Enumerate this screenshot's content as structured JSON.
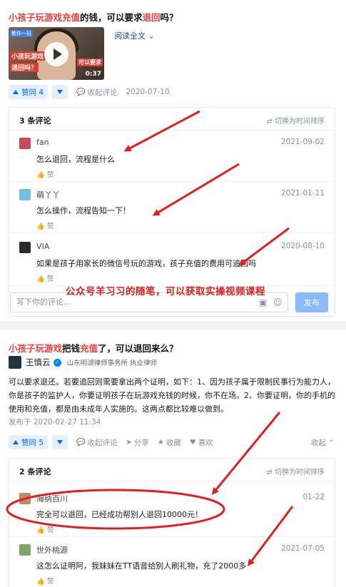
{
  "q1": {
    "title_parts": [
      "小孩子玩游戏充值",
      "的钱，可以要求",
      "退回",
      "吗？"
    ],
    "video": {
      "duration": "0:37",
      "tag": "教你一招",
      "overlay_line1": "小孩玩游戏",
      "overlay_line2": "退回吗？",
      "overlay_line3": "可以要求"
    },
    "read_all": "阅读全文 ⌄",
    "vote_up_label": "赞同 4",
    "collapse_comments": "收起评论",
    "date": "2020-07-10",
    "comments_box": {
      "count_label": "3 条评论",
      "sort_label": "切换为时间排序",
      "comments": [
        {
          "name": "fan",
          "time": "2021-09-02",
          "text": "怎么退回，流程是什么",
          "like": "赞"
        },
        {
          "name": "萌丫丫",
          "time": "2021-01-11",
          "text": "怎么操作，流程告知一下！",
          "like": "赞"
        },
        {
          "name": "VIA",
          "time": "2020-08-10",
          "text": "如果是孩子用家长的微信号玩的游戏，孩子充值的费用可追回吗",
          "like": "赞"
        }
      ],
      "input_placeholder": "写下你的评论...",
      "publish_label": "发布"
    },
    "overlay_caption": "公众号羊习习的随笔，可以获取实操视频课程"
  },
  "q2": {
    "title_parts": [
      "小孩子玩游戏",
      "把钱",
      "充值",
      "了，可以退回来么？"
    ],
    "author": {
      "name": "王慎云",
      "description": "山东明湖律师事务所 执业律师"
    },
    "answer_text": "可以要求退还。若要追回则需要拿出两个证明，如下：1、因为孩子属于限制民事行为能力人，你是孩子的监护人，你要证明孩子在玩游戏充钱的时候，你不在场。2、你要证明，你的手机的使用和充值，都是由未成年人实施的。这两点都比较难以做到。",
    "published": "发布于 2020-02-27 11:34",
    "vote_up_label": "赞同 5",
    "actions": {
      "collapse_comments": "收起评论",
      "share": "分享",
      "favorite": "收藏",
      "like": "喜欢",
      "collapse": "收起"
    },
    "comments_box": {
      "count_label": "2 条评论",
      "sort_label": "切换为时间排序",
      "comments": [
        {
          "name": "海纳百川",
          "time": "01-22",
          "text": "完全可以退回，已经成功帮别人退回10000元！",
          "like": "赞"
        },
        {
          "name": "世外桃源",
          "time": "2021-07-05",
          "text": "这怎么证明阿，我妹妹在TT语音给别人刷礼物，充了2000多",
          "like": "赞"
        }
      ]
    }
  },
  "colors": {
    "highlight": "#f1403c",
    "accent": "#0066ff",
    "annotation_red": "#e02020"
  }
}
